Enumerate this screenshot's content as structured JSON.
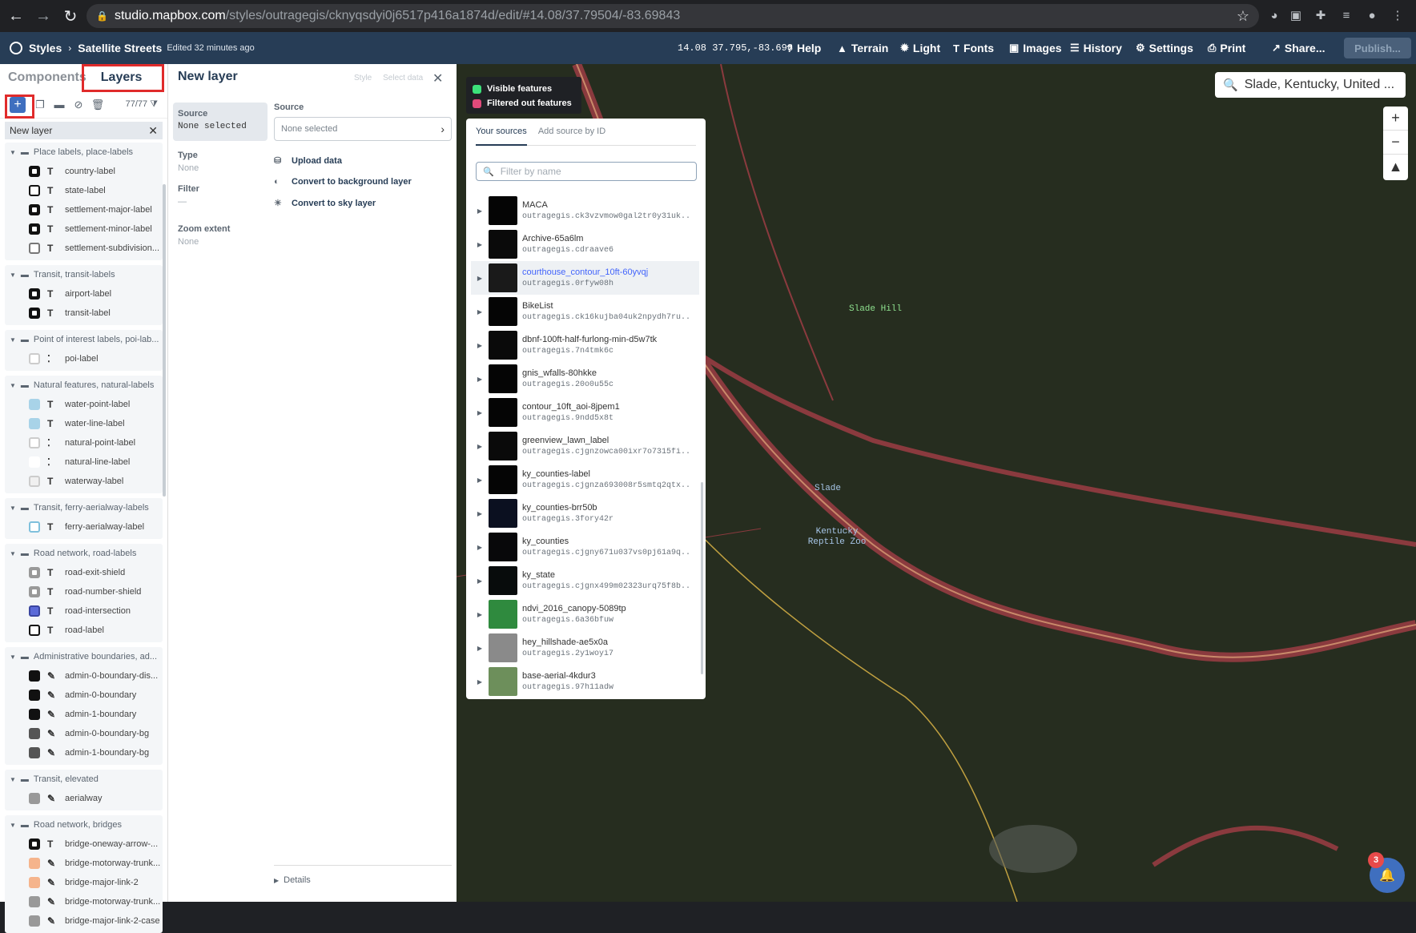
{
  "browser": {
    "url_host": "studio.mapbox.com",
    "url_rest": "/styles/outragegis/cknyqsdyi0j6517p416a1874d/edit/#14.08/37.79504/-83.69843"
  },
  "appbar": {
    "styles": "Styles",
    "style_name": "Satellite Streets",
    "edited": "Edited 32 minutes ago",
    "coords": "14.08 37.795,-83.698",
    "help": "Help",
    "terrain": "Terrain",
    "light": "Light",
    "fonts": "Fonts",
    "images": "Images",
    "history": "History",
    "settings": "Settings",
    "print": "Print",
    "share": "Share...",
    "publish": "Publish..."
  },
  "left": {
    "tab_components": "Components",
    "tab_layers": "Layers",
    "count": "77/77",
    "new_layer": "New layer",
    "groups": [
      {
        "name": "Place labels, place-labels",
        "layers": [
          {
            "name": "country-label",
            "type": "T",
            "color": "#ffffff",
            "border": "#111111"
          },
          {
            "name": "state-label",
            "type": "T",
            "color": "#ffffff",
            "border": "#111111"
          },
          {
            "name": "settlement-major-label",
            "type": "T",
            "color": "#ffffff",
            "border": "#111111"
          },
          {
            "name": "settlement-minor-label",
            "type": "T",
            "color": "#ffffff",
            "border": "#111111"
          },
          {
            "name": "settlement-subdivision...",
            "type": "T",
            "color": "#ffffff",
            "border": "#777777"
          }
        ]
      },
      {
        "name": "Transit, transit-labels",
        "layers": [
          {
            "name": "airport-label",
            "type": "T",
            "color": "#ffffff",
            "border": "#111111"
          },
          {
            "name": "transit-label",
            "type": "T",
            "color": "#ffffff",
            "border": "#111111"
          }
        ]
      },
      {
        "name": "Point of interest labels, poi-lab...",
        "layers": [
          {
            "name": "poi-label",
            "type": "",
            "color": "#ffffff",
            "border": "#cccccc"
          }
        ]
      },
      {
        "name": "Natural features, natural-labels",
        "layers": [
          {
            "name": "water-point-label",
            "type": "T",
            "color": "#a8d3e8",
            "border": "#a8d3e8"
          },
          {
            "name": "water-line-label",
            "type": "T",
            "color": "#a8d3e8",
            "border": "#a8d3e8"
          },
          {
            "name": "natural-point-label",
            "type": "",
            "color": "#ffffff",
            "border": "#cccccc"
          },
          {
            "name": "natural-line-label",
            "type": "",
            "color": "#ffffff",
            "border": "#ffffff"
          },
          {
            "name": "waterway-label",
            "type": "T",
            "color": "#f0f0f0",
            "border": "#cccccc"
          }
        ]
      },
      {
        "name": "Transit, ferry-aerialway-labels",
        "layers": [
          {
            "name": "ferry-aerialway-label",
            "type": "T",
            "color": "#ffffff",
            "border": "#7fc0dc"
          }
        ]
      },
      {
        "name": "Road network, road-labels",
        "layers": [
          {
            "name": "road-exit-shield",
            "type": "T",
            "color": "#ffffff",
            "border": "#999999"
          },
          {
            "name": "road-number-shield",
            "type": "T",
            "color": "#ffffff",
            "border": "#999999"
          },
          {
            "name": "road-intersection",
            "type": "T",
            "color": "#5b6ad8",
            "border": "#3a45a0"
          },
          {
            "name": "road-label",
            "type": "T",
            "color": "#ffffff",
            "border": "#111111"
          }
        ]
      },
      {
        "name": "Administrative boundaries, ad...",
        "layers": [
          {
            "name": "admin-0-boundary-dis...",
            "type": "/",
            "color": "#111111",
            "border": "#111111"
          },
          {
            "name": "admin-0-boundary",
            "type": "/",
            "color": "#111111",
            "border": "#111111"
          },
          {
            "name": "admin-1-boundary",
            "type": "/",
            "color": "#111111",
            "border": "#111111"
          },
          {
            "name": "admin-0-boundary-bg",
            "type": "/",
            "color": "#555555",
            "border": "#555555"
          },
          {
            "name": "admin-1-boundary-bg",
            "type": "/",
            "color": "#555555",
            "border": "#555555"
          }
        ]
      },
      {
        "name": "Transit, elevated",
        "layers": [
          {
            "name": "aerialway",
            "type": "/",
            "color": "#999999",
            "border": "#999999"
          }
        ]
      },
      {
        "name": "Road network, bridges",
        "layers": [
          {
            "name": "bridge-oneway-arrow-...",
            "type": "T",
            "color": "#ffffff",
            "border": "#111111"
          },
          {
            "name": "bridge-motorway-trunk...",
            "type": "/",
            "color": "#f5b48c",
            "border": "#f5b48c"
          },
          {
            "name": "bridge-major-link-2",
            "type": "/",
            "color": "#f5b48c",
            "border": "#f5b48c"
          },
          {
            "name": "bridge-motorway-trunk...",
            "type": "/",
            "color": "#999999",
            "border": "#999999"
          },
          {
            "name": "bridge-major-link-2-case",
            "type": "/",
            "color": "#999999",
            "border": "#999999"
          }
        ]
      }
    ]
  },
  "mid": {
    "title": "New layer",
    "tab_style": "Style",
    "tab_select": "Select data",
    "source_label": "Source",
    "source_value": "None selected",
    "type_label": "Type",
    "type_value": "None",
    "filter_label": "Filter",
    "filter_value": "—",
    "zoom_label": "Zoom extent",
    "zoom_value": "None",
    "source_box_label": "Source",
    "source_box_value": "None selected",
    "upload": "Upload data",
    "bg": "Convert to background layer",
    "sky": "Convert to sky layer",
    "details": "Details"
  },
  "map": {
    "legend_visible": "Visible features",
    "legend_filtered": "Filtered out features",
    "search_value": "Slade, Kentucky, United ...",
    "labels": [
      "Slade Hill",
      "Slade",
      "Kentucky Reptile Zoo"
    ],
    "notifications": "3"
  },
  "popup": {
    "tab_yours": "Your sources",
    "tab_byid": "Add source by ID",
    "filter_placeholder": "Filter by name",
    "sources": [
      {
        "name": "MACA",
        "id": "outragegis.ck3vzvmow0gal2tr0y31uk...",
        "thumb": "#050505"
      },
      {
        "name": "Archive-65a6lm",
        "id": "outragegis.cdraave6",
        "thumb": "#0a0a0a"
      },
      {
        "name": "courthouse_contour_10ft-60yvqj",
        "id": "outragegis.0rfyw08h",
        "thumb": "#1a1a1a"
      },
      {
        "name": "BikeList",
        "id": "outragegis.ck16kujba04uk2npydh7ru...",
        "thumb": "#050505"
      },
      {
        "name": "dbnf-100ft-half-furlong-min-d5w7tk",
        "id": "outragegis.7n4tmk6c",
        "thumb": "#0a0a0a"
      },
      {
        "name": "gnis_wfalls-80hkke",
        "id": "outragegis.20o0u55c",
        "thumb": "#050505"
      },
      {
        "name": "contour_10ft_aoi-8jpem1",
        "id": "outragegis.9ndd5x8t",
        "thumb": "#050505"
      },
      {
        "name": "greenview_lawn_label",
        "id": "outragegis.cjgnzowca00ixr7o7315fi...",
        "thumb": "#0a0a0a"
      },
      {
        "name": "ky_counties-label",
        "id": "outragegis.cjgnza693008r5smtq2qtx...",
        "thumb": "#050505"
      },
      {
        "name": "ky_counties-brr50b",
        "id": "outragegis.3fory42r",
        "thumb": "#0b1020"
      },
      {
        "name": "ky_counties",
        "id": "outragegis.cjgny671u037vs0pj61a9q...",
        "thumb": "#08080a"
      },
      {
        "name": "ky_state",
        "id": "outragegis.cjgnx499m02323urq75f8b...",
        "thumb": "#080c0c"
      },
      {
        "name": "ndvi_2016_canopy-5089tp",
        "id": "outragegis.6a36bfuw",
        "thumb": "#2f8a3e"
      },
      {
        "name": "hey_hillshade-ae5x0a",
        "id": "outragegis.2y1woyi7",
        "thumb": "#8a8a8a"
      },
      {
        "name": "base-aerial-4kdur3",
        "id": "outragegis.97h11adw",
        "thumb": "#6d8f5b"
      }
    ]
  },
  "colors": {
    "accent": "#273d56",
    "highlight": "#e02b2b",
    "visible": "#3ce07a",
    "filtered": "#e04a7a"
  }
}
